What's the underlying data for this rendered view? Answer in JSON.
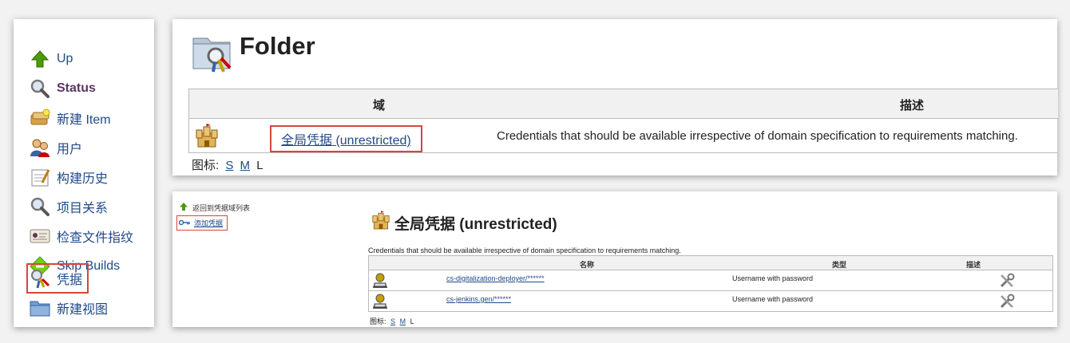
{
  "sidebar": {
    "items": [
      {
        "label": "Up",
        "icon": "up-arrow-icon"
      },
      {
        "label": "Status",
        "icon": "magnifier-icon"
      },
      {
        "label": "新建 Item",
        "icon": "new-item-icon"
      },
      {
        "label": "用户",
        "icon": "users-icon"
      },
      {
        "label": "构建历史",
        "icon": "notepad-icon"
      },
      {
        "label": "项目关系",
        "icon": "magnifier-icon"
      },
      {
        "label": "检查文件指纹",
        "icon": "fingerprint-icon"
      },
      {
        "label": "Skip Builds",
        "icon": "skip-builds-icon"
      },
      {
        "label": "凭据",
        "icon": "credentials-icon"
      },
      {
        "label": "新建视图",
        "icon": "folder-icon"
      }
    ]
  },
  "folder": {
    "title": "Folder",
    "table": {
      "col_domain": "域",
      "col_desc": "描述",
      "row_link": "全局凭据 (unrestricted)",
      "row_desc": "Credentials that should be available irrespective of domain specification to requirements matching."
    },
    "icon_size": {
      "label": "图标:",
      "s": "S",
      "m": "M",
      "l": "L"
    }
  },
  "credentials": {
    "nav_back": "返回到凭据域列表",
    "nav_add": "添加凭据",
    "title": "全局凭据 (unrestricted)",
    "description": "Credentials that should be available irrespective of domain specification to requirements matching.",
    "col_name": "名称",
    "col_type": "类型",
    "col_desc": "描述",
    "rows": [
      {
        "name": "cs-digitalization-deployer/******",
        "type": "Username with password"
      },
      {
        "name": "cs-jenkins.gen/******",
        "type": "Username with password"
      }
    ],
    "icon_size": {
      "label": "图标:",
      "s": "S",
      "m": "M",
      "l": "L"
    }
  },
  "colors": {
    "link": "#204a87",
    "highlight": "#d9453d",
    "header_bg": "#f1f1f1"
  }
}
